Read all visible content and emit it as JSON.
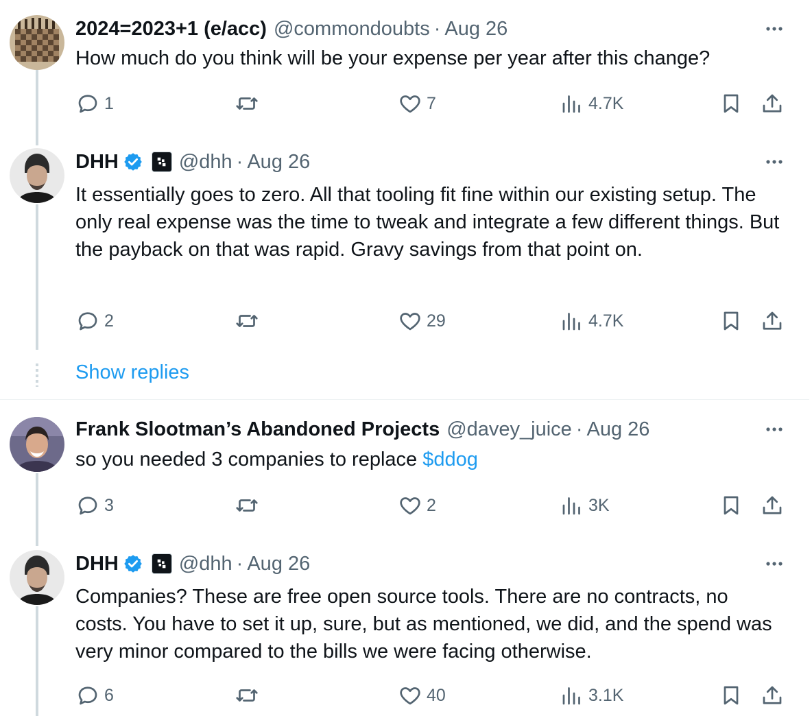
{
  "tweets": [
    {
      "display_name": "2024=2023+1 (e/acc)",
      "handle": "@commondoubts",
      "separator": "·",
      "time": "Aug 26",
      "verified": false,
      "text": "How much do you think will be your expense per year after this change?",
      "replies": "1",
      "retweets": "",
      "likes": "7",
      "views": "4.7K",
      "avatar": "chessboard-avatar"
    },
    {
      "display_name": "DHH",
      "handle": "@dhh",
      "separator": "·",
      "time": "Aug 26",
      "verified": true,
      "text": "It essentially goes to zero. All that tooling fit fine within our existing setup. The only real expense was the time to tweak and integrate a few different things. But the payback on that was rapid. Gravy savings from that point on.",
      "replies": "2",
      "retweets": "",
      "likes": "29",
      "views": "4.7K",
      "avatar": "portrait-avatar"
    },
    {
      "display_name": "Frank Slootman’s Abandoned Projects",
      "handle": "@davey_juice",
      "separator": "·",
      "time": "Aug 26",
      "verified": false,
      "text": "so you needed 3 companies to replace ",
      "cashtag": "$ddog",
      "replies": "3",
      "retweets": "",
      "likes": "2",
      "views": "3K",
      "avatar": "portrait-avatar"
    },
    {
      "display_name": "DHH",
      "handle": "@dhh",
      "separator": "·",
      "time": "Aug 26",
      "verified": true,
      "text": "Companies? These are free open source tools. There are no contracts, no costs. You have to set it up, sure, but as mentioned, we did, and the spend was very minor compared to the bills we were facing otherwise.",
      "replies": "6",
      "retweets": "",
      "likes": "40",
      "views": "3.1K",
      "avatar": "portrait-avatar"
    }
  ],
  "show_replies_label": "Show replies",
  "colors": {
    "text": "#0f1419",
    "secondary": "#536471",
    "link": "#1d9bf0",
    "verified": "#1d9bf0",
    "thread_line": "#cfd9de"
  }
}
